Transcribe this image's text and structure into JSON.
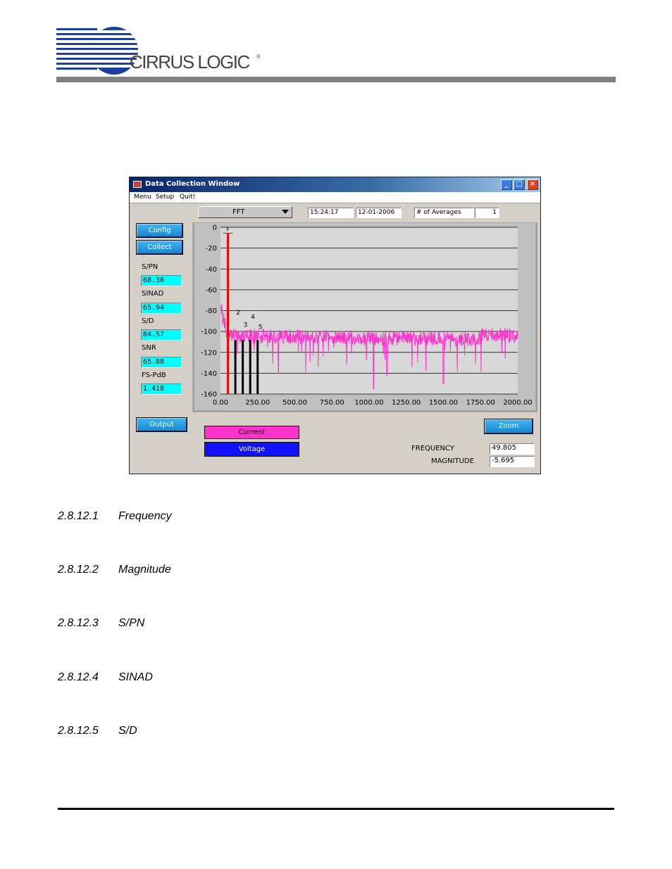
{
  "header": {
    "logo_text": "CIRRUS LOGIC",
    "logo_reg": "®"
  },
  "window": {
    "title": "Data Collection Window",
    "menu": [
      "Menu",
      "Setup",
      "Quit!"
    ],
    "controls": {
      "mode": "FFT",
      "time": "15:24:17",
      "date": "12-01-2006",
      "averages_label": "# of Averages",
      "averages_value": "1"
    },
    "buttons": {
      "config": "Config",
      "collect": "Collect",
      "output": "Output",
      "zoom": "Zoom",
      "current": "Current",
      "voltage": "Voltage"
    },
    "metrics": [
      {
        "label": "S/PN",
        "value": "68.36"
      },
      {
        "label": "SINAD",
        "value": "65.94"
      },
      {
        "label": "S/D",
        "value": "84.57"
      },
      {
        "label": "SNR",
        "value": "65.88"
      },
      {
        "label": "FS-PdB",
        "value": "1.418"
      }
    ],
    "readout": {
      "frequency_label": "FREQUENCY",
      "frequency_value": "49.805",
      "magnitude_label": "MAGNITUDE",
      "magnitude_value": "-5.695"
    },
    "colors": {
      "current": "#ff33cc",
      "voltage": "#1010ff",
      "fundamental": "#ff0000",
      "harmonics": "#000000",
      "metric_box": "#00ffff",
      "plot_bg": "#d8d8d8"
    }
  },
  "chart_data": {
    "type": "line",
    "title": "",
    "xlabel": "",
    "ylabel": "",
    "xlim": [
      0,
      2000
    ],
    "ylim": [
      -160,
      0
    ],
    "x_ticks": [
      "0.00",
      "250.00",
      "500.00",
      "750.00",
      "1000.00",
      "1250.00",
      "1500.00",
      "1750.00",
      "2000.00"
    ],
    "y_ticks": [
      "0",
      "-20",
      "-40",
      "-60",
      "-80",
      "-100",
      "-120",
      "-140",
      "-160"
    ],
    "grid": true,
    "fundamental": {
      "label": "F",
      "x": 49.805,
      "y": -5.695
    },
    "harmonics": [
      {
        "label": "2",
        "x": 100,
        "y": -85
      },
      {
        "label": "3",
        "x": 150,
        "y": -97
      },
      {
        "label": "4",
        "x": 200,
        "y": -89
      },
      {
        "label": "5",
        "x": 250,
        "y": -99
      }
    ],
    "series": [
      {
        "name": "Current",
        "noise_floor_start": -100,
        "noise_floor_end": -104,
        "low_end_start": -70,
        "spurs": [
          {
            "x": 1030,
            "y": -155
          },
          {
            "x": 1500,
            "y": -150
          },
          {
            "x": 390,
            "y": -140
          },
          {
            "x": 1120,
            "y": -142
          }
        ]
      }
    ]
  },
  "document": {
    "sections": [
      {
        "number": "2.8.12.1",
        "title": "Frequency"
      },
      {
        "number": "2.8.12.2",
        "title": "Magnitude"
      },
      {
        "number": "2.8.12.3",
        "title": "S/PN"
      },
      {
        "number": "2.8.12.4",
        "title": "SINAD"
      },
      {
        "number": "2.8.12.5",
        "title": "S/D"
      }
    ]
  }
}
